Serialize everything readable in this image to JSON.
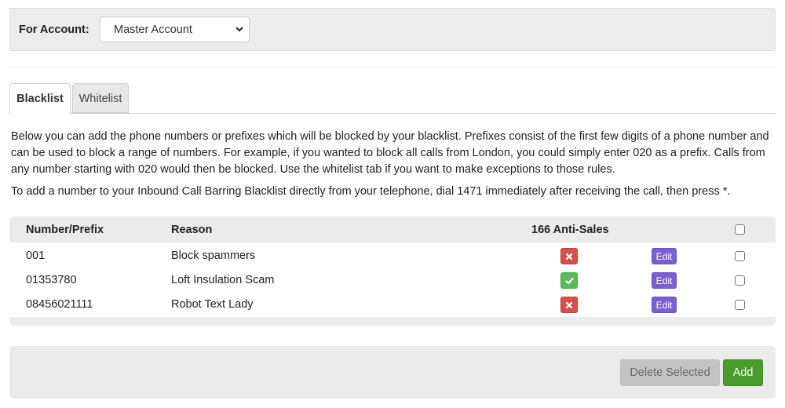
{
  "account": {
    "label": "For Account:",
    "selected": "Master Account"
  },
  "tabs": [
    {
      "label": "Blacklist",
      "active": true
    },
    {
      "label": "Whitelist",
      "active": false
    }
  ],
  "description": {
    "paragraph1": "Below you can add the phone numbers or prefixes which will be blocked by your blacklist. Prefixes consist of the first few digits of a phone number and can be used to block a range of numbers. For example, if you wanted to block all calls from London, you could simply enter 020 as a prefix. Calls from any number starting with 020 would then be blocked. Use the whitelist tab if you want to make exceptions to those rules.",
    "paragraph2": "To add a number to your Inbound Call Barring Blacklist directly from your telephone, dial 1471 immediately after receiving the call, then press *."
  },
  "table": {
    "headers": {
      "number": "Number/Prefix",
      "reason": "Reason",
      "anti_sales": "166 Anti-Sales"
    },
    "rows": [
      {
        "number": "001",
        "reason": "Block spammers",
        "anti_sales": false,
        "edit_label": "Edit"
      },
      {
        "number": "01353780",
        "reason": "Loft Insulation Scam",
        "anti_sales": true,
        "edit_label": "Edit"
      },
      {
        "number": "08456021111",
        "reason": "Robot Text Lady",
        "anti_sales": false,
        "edit_label": "Edit"
      }
    ]
  },
  "footer": {
    "delete_label": "Delete Selected",
    "add_label": "Add"
  },
  "colors": {
    "status_no": "#d0524c",
    "status_yes": "#5cb85c",
    "edit": "#7b5fcf",
    "add": "#4a9a2e"
  }
}
